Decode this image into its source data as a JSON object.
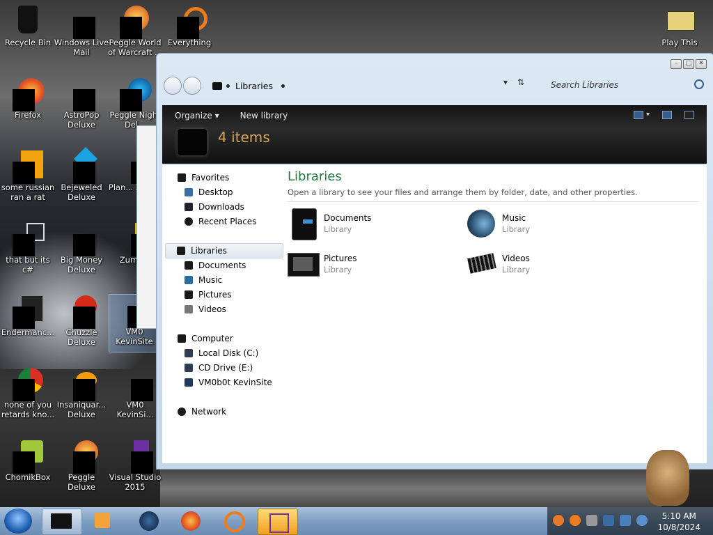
{
  "desktop": {
    "icons": [
      {
        "label": "Recycle Bin"
      },
      {
        "label": "Windows Live Mail"
      },
      {
        "label": "Peggle World of Warcraft ..."
      },
      {
        "label": "Everything"
      },
      {
        "label": "Firefox"
      },
      {
        "label": "AstroPop Deluxe"
      },
      {
        "label": "Peggle Night Del..."
      },
      {
        "label": "some russian ran a rat"
      },
      {
        "label": "Bejeweled Deluxe"
      },
      {
        "label": "Plan... Zom..."
      },
      {
        "label": "that but its c#"
      },
      {
        "label": "Big Money Deluxe"
      },
      {
        "label": "Zuma..."
      },
      {
        "label": "Endermanc..."
      },
      {
        "label": "Chuzzle Deluxe"
      },
      {
        "label": "VM0 KevinSite"
      },
      {
        "label": "none of you retards kno..."
      },
      {
        "label": "Insaniquar... Deluxe"
      },
      {
        "label": "VM0 KevinSi..."
      },
      {
        "label": "ChomikBox"
      },
      {
        "label": "Peggle Deluxe"
      },
      {
        "label": "Visual Studio 2015"
      },
      {
        "label": "Play This"
      }
    ]
  },
  "explorer": {
    "address": {
      "text": "Libraries"
    },
    "search": {
      "placeholder": "Search Libraries"
    },
    "toolbar": {
      "organize": "Organize ▾",
      "new_library": "New library"
    },
    "item_count": "4 items",
    "nav": {
      "favorites": "Favorites",
      "desktop": "Desktop",
      "downloads": "Downloads",
      "recent": "Recent Places",
      "libraries": "Libraries",
      "documents": "Documents",
      "music": "Music",
      "pictures": "Pictures",
      "videos": "Videos",
      "computer": "Computer",
      "local_disk": "Local Disk (C:)",
      "cd_drive": "CD Drive (E:)",
      "kevinsite": "VM0b0t KevinSite",
      "network": "Network"
    },
    "main": {
      "title": "Libraries",
      "subtitle": "Open a library to see your files and arrange them by folder, date, and other properties.",
      "libraries": [
        {
          "name": "Documents",
          "type": "Library"
        },
        {
          "name": "Music",
          "type": "Library"
        },
        {
          "name": "Pictures",
          "type": "Library"
        },
        {
          "name": "Videos",
          "type": "Library"
        }
      ]
    }
  },
  "taskbar": {
    "clock_time": "5:10 AM",
    "clock_date": "10/8/2024"
  }
}
